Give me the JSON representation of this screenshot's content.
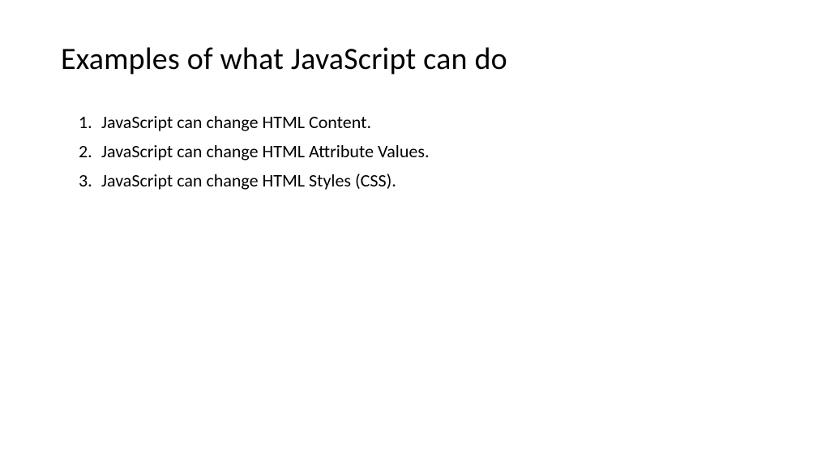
{
  "title": "Examples of what JavaScript can do",
  "items": [
    "JavaScript can change HTML Content.",
    "JavaScript can change HTML Attribute Values.",
    "JavaScript can change HTML Styles (CSS)."
  ]
}
